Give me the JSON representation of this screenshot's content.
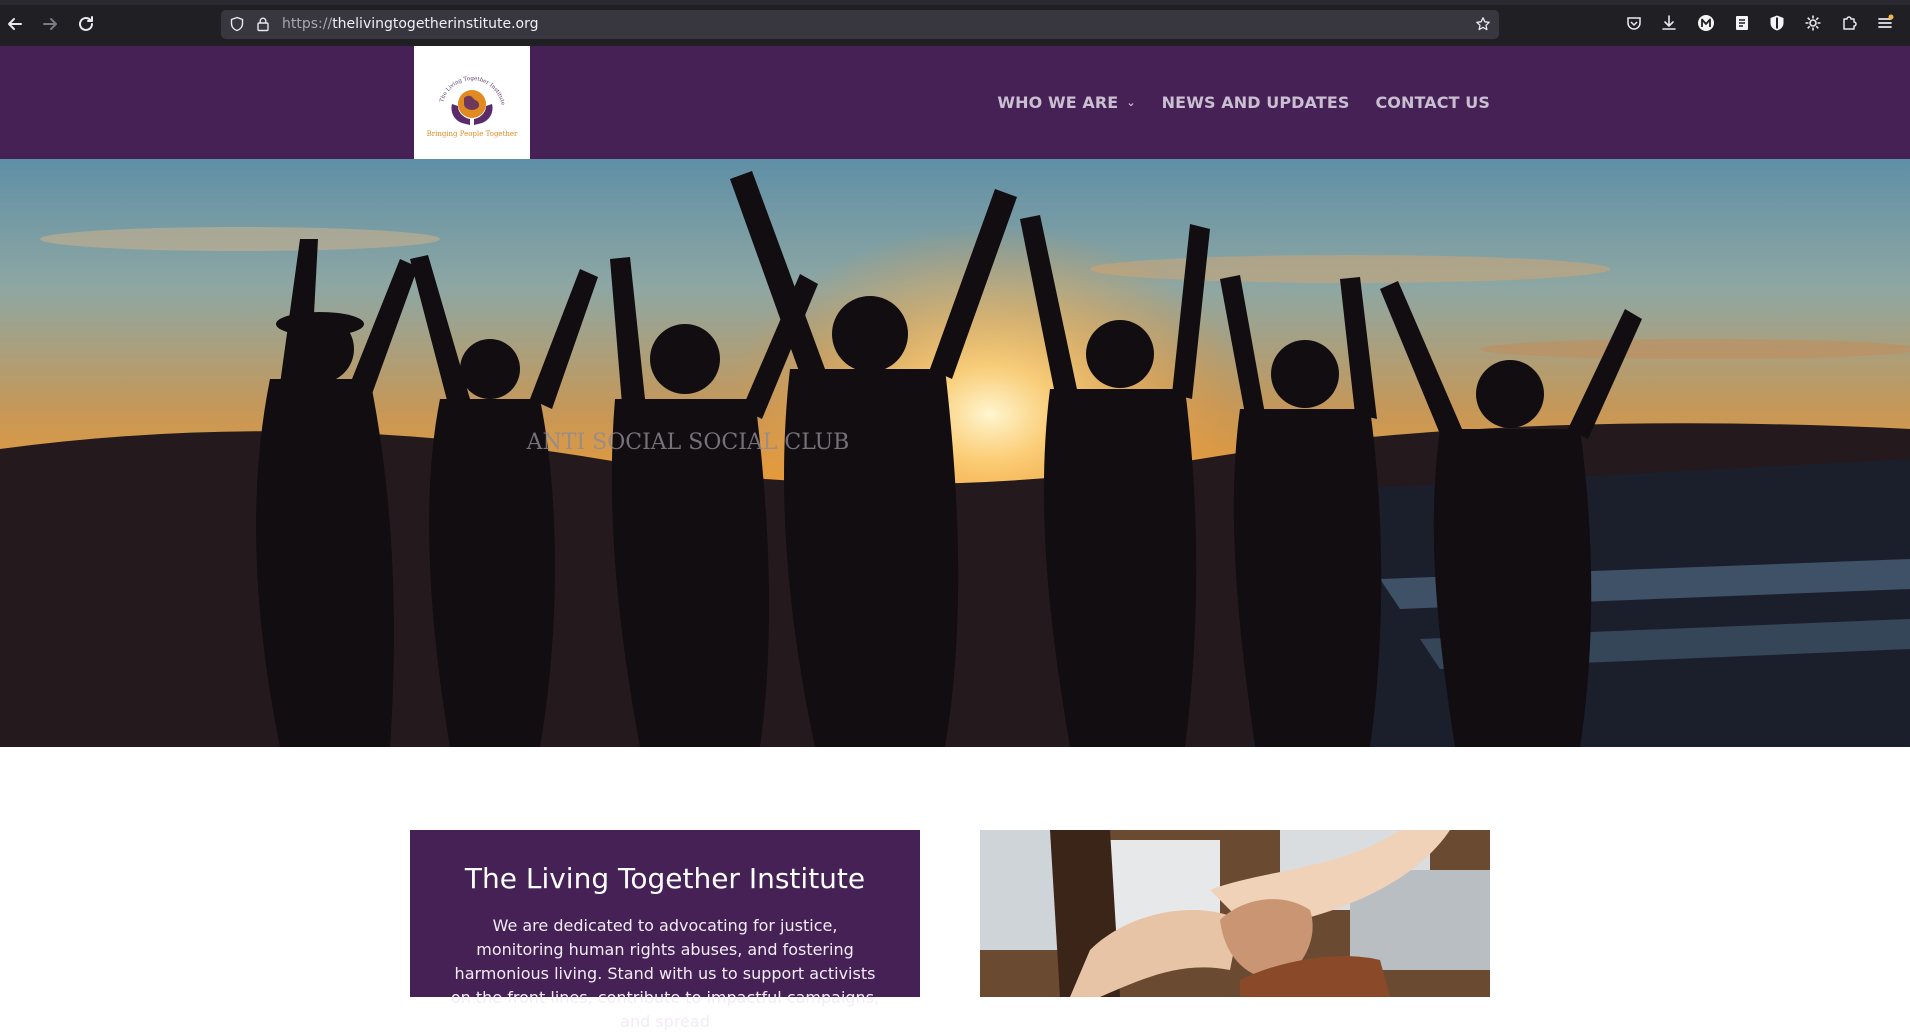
{
  "browser": {
    "url_protocol": "https://",
    "url_host": "thelivingtogetherinstitute.org",
    "back_icon": "arrow-left",
    "forward_icon": "arrow-right",
    "reload_icon": "reload",
    "toolbar_icons": [
      "pocket",
      "download",
      "account-m",
      "reader",
      "ublock",
      "extension-gear",
      "extensions",
      "menu"
    ]
  },
  "site": {
    "logo": {
      "arc_text": "The Living Together Institute",
      "tagline": "Bringing People Together"
    },
    "nav": [
      {
        "label": "WHO WE ARE",
        "has_dropdown": true
      },
      {
        "label": "NEWS AND UPDATES",
        "has_dropdown": false
      },
      {
        "label": "CONTACT US",
        "has_dropdown": false
      }
    ],
    "colors": {
      "brand_purple": "#452156",
      "nav_text": "#c9bfd0"
    }
  },
  "hero": {
    "image_description": "silhouetted group raising hands at sunset",
    "shirt_text": "ANTI SOCIAL SOCIAL CLUB"
  },
  "intro": {
    "title": "The Living Together Institute",
    "text": "We are dedicated to advocating for justice, monitoring human rights abuses, and fostering harmonious living. Stand with us to support activists on the front lines, contribute to impactful campaigns, and spread"
  }
}
